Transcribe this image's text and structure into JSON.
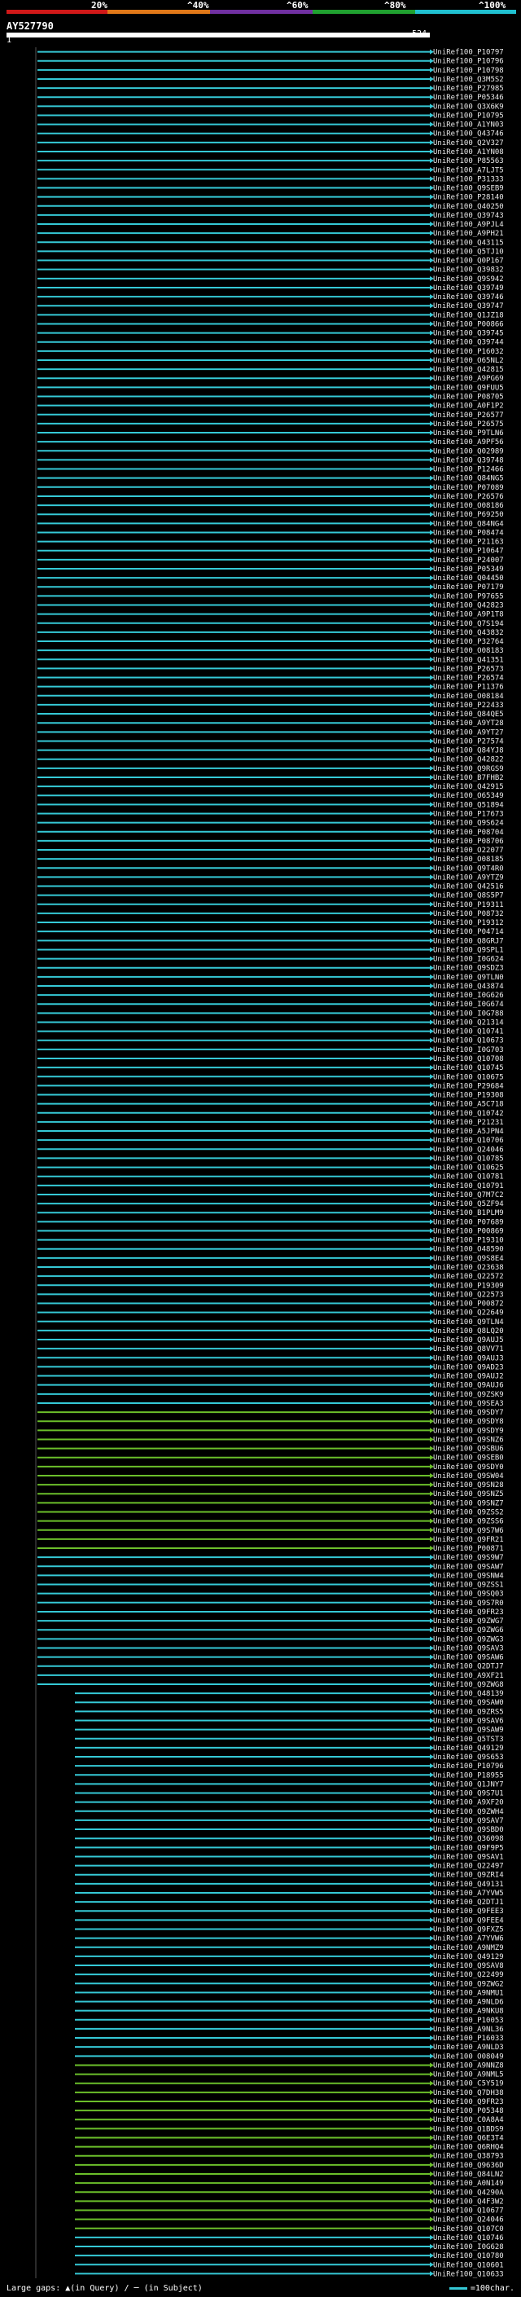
{
  "legend": {
    "ticks": [
      "20%",
      "^40%",
      "^60%",
      "^80%",
      "^100%"
    ],
    "colors": [
      "#d01818",
      "#e07818",
      "#7030a0",
      "#20a030",
      "#20c0d0"
    ]
  },
  "query": {
    "accession": "AY527790",
    "ruler_start": "1",
    "ruler_end": "524"
  },
  "colors": {
    "cyan": "#35c9d6",
    "green": "#6bbf2a",
    "background": "#000000",
    "label": "#e8e8e8"
  },
  "hits": [
    "UniRef100_P10797",
    "UniRef100_P10796",
    "UniRef100_P10798",
    "UniRef100_Q3M5S2",
    "UniRef100_P27985",
    "UniRef100_P05346",
    "UniRef100_Q3X6K9",
    "UniRef100_P10795",
    "UniRef100_A1YN03",
    "UniRef100_Q43746",
    "UniRef100_Q2V327",
    "UniRef100_A1YN08",
    "UniRef100_P85563",
    "UniRef100_A7LJT5",
    "UniRef100_P31333",
    "UniRef100_Q9SEB9",
    "UniRef100_P28140",
    "UniRef100_Q40250",
    "UniRef100_Q39743",
    "UniRef100_A9PJL4",
    "UniRef100_A9PH21",
    "UniRef100_Q43115",
    "UniRef100_Q5TJ10",
    "UniRef100_Q0P167",
    "UniRef100_Q39832",
    "UniRef100_Q9S942",
    "UniRef100_Q39749",
    "UniRef100_Q39746",
    "UniRef100_Q39747",
    "UniRef100_Q1JZ18",
    "UniRef100_P00866",
    "UniRef100_Q39745",
    "UniRef100_Q39744",
    "UniRef100_P16032",
    "UniRef100_O65NL2",
    "UniRef100_Q42815",
    "UniRef100_A9PG69",
    "UniRef100_Q9FUU5",
    "UniRef100_P08705",
    "UniRef100_A0F1P2",
    "UniRef100_P26577",
    "UniRef100_P26575",
    "UniRef100_P9TLN6",
    "UniRef100_A9PF56",
    "UniRef100_Q02989",
    "UniRef100_Q39748",
    "UniRef100_P12466",
    "UniRef100_Q84NG5",
    "UniRef100_P07089",
    "UniRef100_P26576",
    "UniRef100_O08186",
    "UniRef100_P69250",
    "UniRef100_Q84NG4",
    "UniRef100_P08474",
    "UniRef100_P21163",
    "UniRef100_P10647",
    "UniRef100_P24007",
    "UniRef100_P05349",
    "UniRef100_Q04450",
    "UniRef100_P07179",
    "UniRef100_P97655",
    "UniRef100_Q42823",
    "UniRef100_A9P1T8",
    "UniRef100_Q7S194",
    "UniRef100_Q43832",
    "UniRef100_P32764",
    "UniRef100_O08183",
    "UniRef100_Q41351",
    "UniRef100_P26573",
    "UniRef100_P26574",
    "UniRef100_P11376",
    "UniRef100_O08184",
    "UniRef100_P22433",
    "UniRef100_Q84QE5",
    "UniRef100_A9YT28",
    "UniRef100_A9YT27",
    "UniRef100_P27574",
    "UniRef100_Q84YJ8",
    "UniRef100_Q42822",
    "UniRef100_Q9RGS9",
    "UniRef100_B7FHB2",
    "UniRef100_Q42915",
    "UniRef100_O65349",
    "UniRef100_Q51894",
    "UniRef100_P17673",
    "UniRef100_Q9S624",
    "UniRef100_P08704",
    "UniRef100_P08706",
    "UniRef100_O22077",
    "UniRef100_O08185",
    "UniRef100_Q9T4R0",
    "UniRef100_A9YTZ9",
    "UniRef100_Q42516",
    "UniRef100_Q8S5P7",
    "UniRef100_P19311",
    "UniRef100_P08732",
    "UniRef100_P19312",
    "UniRef100_P04714",
    "UniRef100_Q8GRJ7",
    "UniRef100_Q9SPL1",
    "UniRef100_I0G624",
    "UniRef100_Q9SDZ3",
    "UniRef100_Q9TLN0",
    "UniRef100_Q43874",
    "UniRef100_I0G626",
    "UniRef100_I0G674",
    "UniRef100_I0G788",
    "UniRef100_Q21314",
    "UniRef100_Q10741",
    "UniRef100_Q10673",
    "UniRef100_I0G703",
    "UniRef100_Q10708",
    "UniRef100_Q10745",
    "UniRef100_Q10675",
    "UniRef100_P29684",
    "UniRef100_P19308",
    "UniRef100_A5C718",
    "UniRef100_Q10742",
    "UniRef100_P21231",
    "UniRef100_A5JPN4",
    "UniRef100_Q10706",
    "UniRef100_Q24046",
    "UniRef100_Q10785",
    "UniRef100_Q10625",
    "UniRef100_Q10781",
    "UniRef100_Q10791",
    "UniRef100_Q7M7C2",
    "UniRef100_Q5ZF94",
    "UniRef100_B1PLM9",
    "UniRef100_P07689",
    "UniRef100_P00869",
    "UniRef100_P19310",
    "UniRef100_O48590",
    "UniRef100_Q9S8E4",
    "UniRef100_O23638",
    "UniRef100_Q22572",
    "UniRef100_P19309",
    "UniRef100_Q22573",
    "UniRef100_P00872",
    "UniRef100_Q22649",
    "UniRef100_Q9TLN4",
    "UniRef100_Q8LQ20",
    "UniRef100_Q9AUJ5",
    "UniRef100_Q8VV71",
    "UniRef100_Q9AUJ3",
    "UniRef100_Q9AD23",
    "UniRef100_Q9AUJ2",
    "UniRef100_Q9AUJ6",
    "UniRef100_Q9ZSK9",
    "UniRef100_Q9SEA3",
    "UniRef100_Q9SDY7",
    "UniRef100_Q9SDY8",
    "UniRef100_Q9SDY9",
    "UniRef100_Q9SNZ6",
    "UniRef100_Q9SBU6",
    "UniRef100_Q9SEB0",
    "UniRef100_Q9SDY0",
    "UniRef100_Q9SW04",
    "UniRef100_Q9SN28",
    "UniRef100_Q9SNZ5",
    "UniRef100_Q9SNZ7",
    "UniRef100_Q9ZSS2",
    "UniRef100_Q9ZSS6",
    "UniRef100_Q9S7W6",
    "UniRef100_Q9FR21",
    "UniRef100_P00871",
    "UniRef100_Q9S9W7",
    "UniRef100_Q9SAW7",
    "UniRef100_Q9SNW4",
    "UniRef100_Q9ZSS1",
    "UniRef100_Q9SQ03",
    "UniRef100_Q9S7R0",
    "UniRef100_Q9FR23",
    "UniRef100_Q9ZWG7",
    "UniRef100_Q9ZWG6",
    "UniRef100_Q9ZWG3",
    "UniRef100_Q9SAV3",
    "UniRef100_Q9SAW6",
    "UniRef100_Q2DTJ7",
    "UniRef100_A9XF21",
    "UniRef100_Q9ZWG8",
    "UniRef100_Q48139",
    "UniRef100_Q9SAW0",
    "UniRef100_Q9ZRS5",
    "UniRef100_Q9SAV6",
    "UniRef100_Q9SAW9",
    "UniRef100_Q5TST3",
    "UniRef100_Q49129",
    "UniRef100_Q9S653",
    "UniRef100_P10796",
    "UniRef100_P18955",
    "UniRef100_Q1JNY7",
    "UniRef100_Q9S7U1",
    "UniRef100_A9XF20",
    "UniRef100_Q9ZWH4",
    "UniRef100_Q9SAV7",
    "UniRef100_Q9SBD0",
    "UniRef100_Q36098",
    "UniRef100_Q9F9P5",
    "UniRef100_Q9SAV1",
    "UniRef100_Q22497",
    "UniRef100_Q9ZRI4",
    "UniRef100_Q49131",
    "UniRef100_A7YVW5",
    "UniRef100_Q2DTJ1",
    "UniRef100_Q9FEE3",
    "UniRef100_Q9FEE4",
    "UniRef100_Q9FXZ5",
    "UniRef100_A7YVW6",
    "UniRef100_A9NMZ9",
    "UniRef100_Q49129",
    "UniRef100_Q9SAV8",
    "UniRef100_Q22499",
    "UniRef100_Q9ZWG2",
    "UniRef100_A9NMU1",
    "UniRef100_A9NLD6",
    "UniRef100_A9NKU8",
    "UniRef100_P10053",
    "UniRef100_A9NL36",
    "UniRef100_P16033",
    "UniRef100_A9NLD3",
    "UniRef100_O08049",
    "UniRef100_A9NNZ8",
    "UniRef100_A9NML5",
    "UniRef100_C5Y519",
    "UniRef100_Q7DH38",
    "UniRef100_Q9FR23",
    "UniRef100_P05348",
    "UniRef100_C0A8A4",
    "UniRef100_Q1BDS9",
    "UniRef100_Q6E3T4",
    "UniRef100_Q6RHQ4",
    "UniRef100_Q38793",
    "UniRef100_Q9636D",
    "UniRef100_Q84LN2",
    "UniRef100_A0N149",
    "UniRef100_Q4290A",
    "UniRef100_Q4F3W2",
    "UniRef100_Q10677",
    "UniRef100_Q24046",
    "UniRef100_Q107C0",
    "UniRef100_Q10746",
    "UniRef100_I0G628",
    "UniRef100_Q10780",
    "UniRef100_Q10601",
    "UniRef100_Q10633"
  ],
  "footer": {
    "gaps_label": "Large gaps: ▲(in Query) / ─ (in Subject)",
    "scale_label": "=100char."
  }
}
